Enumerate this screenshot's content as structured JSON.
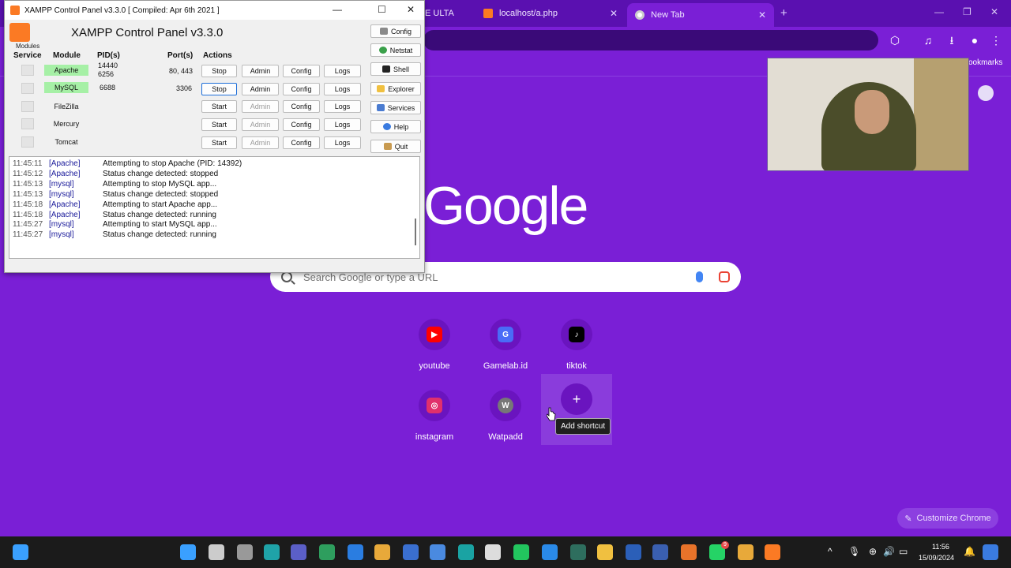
{
  "chrome": {
    "tabs": [
      {
        "title": "E ULTA",
        "active": false
      },
      {
        "title": "localhost/a.php",
        "active": false
      },
      {
        "title": "New Tab",
        "active": true
      }
    ],
    "bookmarks_label": "ookmarks",
    "search_placeholder": "Search Google or type a URL",
    "logo_text": "Google",
    "shortcuts": [
      {
        "label": "youtube",
        "icon": "youtube-icon",
        "color": "#ff0000"
      },
      {
        "label": "Gamelab.id",
        "icon": "gamelab-icon",
        "color": "#4a6cf7"
      },
      {
        "label": "tiktok",
        "icon": "tiktok-icon",
        "color": "#000000"
      },
      {
        "label": "instagram",
        "icon": "instagram-icon",
        "color": "#e1306c"
      },
      {
        "label": "Watpadd",
        "icon": "watpadd-icon",
        "color": "#777777",
        "letter": "W"
      }
    ],
    "add_shortcut_symbol": "+",
    "add_shortcut_tooltip": "Add shortcut",
    "customize_label": "Customize Chrome"
  },
  "xampp": {
    "window_title": "XAMPP Control Panel v3.3.0   [ Compiled: Apr 6th 2021 ]",
    "header_title": "XAMPP Control Panel v3.3.0",
    "modules_label": "Modules",
    "columns": {
      "service": "Service",
      "module": "Module",
      "pid": "PID(s)",
      "port": "Port(s)",
      "actions": "Actions"
    },
    "rows": [
      {
        "module": "Apache",
        "running": true,
        "pid1": "14440",
        "pid2": "6256",
        "port": "80, 443",
        "action": "Stop",
        "admin": "Admin",
        "config": "Config",
        "logs": "Logs"
      },
      {
        "module": "MySQL",
        "running": true,
        "pid1": "6688",
        "pid2": "",
        "port": "3306",
        "action": "Stop",
        "admin": "Admin",
        "config": "Config",
        "logs": "Logs"
      },
      {
        "module": "FileZilla",
        "running": false,
        "pid1": "",
        "pid2": "",
        "port": "",
        "action": "Start",
        "admin": "Admin",
        "config": "Config",
        "logs": "Logs"
      },
      {
        "module": "Mercury",
        "running": false,
        "pid1": "",
        "pid2": "",
        "port": "",
        "action": "Start",
        "admin": "Admin",
        "config": "Config",
        "logs": "Logs"
      },
      {
        "module": "Tomcat",
        "running": false,
        "pid1": "",
        "pid2": "",
        "port": "",
        "action": "Start",
        "admin": "Admin",
        "config": "Config",
        "logs": "Logs"
      }
    ],
    "side_buttons": [
      {
        "label": "Config",
        "icon": "wrench-icon",
        "color": "#8a8a8a"
      },
      {
        "label": "Netstat",
        "icon": "globe-icon",
        "color": "#3aa04a"
      },
      {
        "label": "Shell",
        "icon": "terminal-icon",
        "color": "#222222"
      },
      {
        "label": "Explorer",
        "icon": "folder-icon",
        "color": "#f0c040"
      },
      {
        "label": "Services",
        "icon": "services-icon",
        "color": "#4a7bd0"
      },
      {
        "label": "Help",
        "icon": "help-icon",
        "color": "#3a7be0"
      },
      {
        "label": "Quit",
        "icon": "quit-icon",
        "color": "#c89a50"
      }
    ],
    "log": [
      {
        "time": "11:45:11",
        "module": "[Apache]",
        "message": "Attempting to stop Apache (PID: 14392)"
      },
      {
        "time": "11:45:12",
        "module": "[Apache]",
        "message": "Status change detected: stopped"
      },
      {
        "time": "11:45:13",
        "module": "[mysql]",
        "message": "Attempting to stop MySQL app..."
      },
      {
        "time": "11:45:13",
        "module": "[mysql]",
        "message": "Status change detected: stopped"
      },
      {
        "time": "11:45:18",
        "module": "[Apache]",
        "message": "Attempting to start Apache app..."
      },
      {
        "time": "11:45:18",
        "module": "[Apache]",
        "message": "Status change detected: running"
      },
      {
        "time": "11:45:27",
        "module": "[mysql]",
        "message": "Attempting to start MySQL app..."
      },
      {
        "time": "11:45:27",
        "module": "[mysql]",
        "message": "Status change detected: running"
      }
    ]
  },
  "taskbar": {
    "time": "11:56",
    "date": "15/09/2024",
    "whatsapp_badge": "9",
    "apps": [
      {
        "icon": "start-icon",
        "color": "#3aa0ff"
      },
      {
        "icon": "search-icon",
        "color": "#cccccc"
      },
      {
        "icon": "task-view-icon",
        "color": "#999999"
      },
      {
        "icon": "edge-icon",
        "color": "#1fa3a8"
      },
      {
        "icon": "teams-icon",
        "color": "#5b5fc7"
      },
      {
        "icon": "edge-dev-icon",
        "color": "#2e9e5e"
      },
      {
        "icon": "mail-icon",
        "color": "#2a7de1"
      },
      {
        "icon": "chrome-icon",
        "color": "#e8a93a"
      },
      {
        "icon": "vpn-icon",
        "color": "#3a6fd0"
      },
      {
        "icon": "browser-icon",
        "color": "#4a8ae0"
      },
      {
        "icon": "arduino-icon",
        "color": "#1aa3a3"
      },
      {
        "icon": "3d-icon",
        "color": "#dddddd"
      },
      {
        "icon": "phone-icon",
        "color": "#22c55e"
      },
      {
        "icon": "vscode-icon",
        "color": "#2a8ae8"
      },
      {
        "icon": "terminal-app-icon",
        "color": "#2e6e5e"
      },
      {
        "icon": "explorer-icon",
        "color": "#f0c040"
      },
      {
        "icon": "word-icon",
        "color": "#2b5fb8"
      },
      {
        "icon": "dev-icon",
        "color": "#3a5fb0"
      },
      {
        "icon": "app-icon",
        "color": "#e8732a"
      },
      {
        "icon": "whatsapp-icon",
        "color": "#25d366"
      },
      {
        "icon": "chrome-profile-icon",
        "color": "#e8a93a"
      },
      {
        "icon": "xampp-icon",
        "color": "#fb7a24"
      }
    ]
  }
}
